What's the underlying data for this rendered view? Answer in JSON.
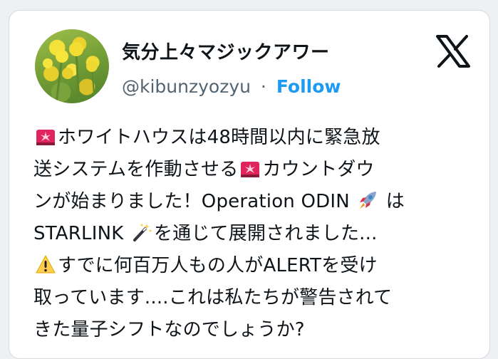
{
  "tweet": {
    "author": {
      "display_name": "気分上々マジックアワー",
      "handle": "@kibunzyozyu",
      "separator": "·",
      "follow_label": "Follow"
    },
    "platform_icon": "x-logo-icon",
    "body_lines": [
      {
        "prefix_icon": "siren-emoji-icon",
        "text": "ホワイトハウスは48時間以内に緊急放"
      },
      {
        "text_before": "送システムを作動させる",
        "icon": "siren-emoji-icon",
        "text_after": "カウントダウ"
      },
      {
        "text_before": "ンが始まりました！Operation ODIN",
        "icon": "rocket-emoji-icon",
        "text_after": "は"
      },
      {
        "text_before": "STARLINK",
        "icon": "magic-wand-emoji-icon",
        "text_after": "を通じて展開されました..."
      },
      {
        "prefix_icon": "warning-emoji-icon",
        "text": "すでに何百万人もの人がALERTを受け"
      },
      {
        "text": "取っています....これは私たちが警告されて"
      },
      {
        "text": "きた量子シフトなのでしょうか?"
      }
    ]
  },
  "colors": {
    "link_blue": "#1d9bf0",
    "text_primary": "#0f1419",
    "text_secondary": "#536471"
  }
}
